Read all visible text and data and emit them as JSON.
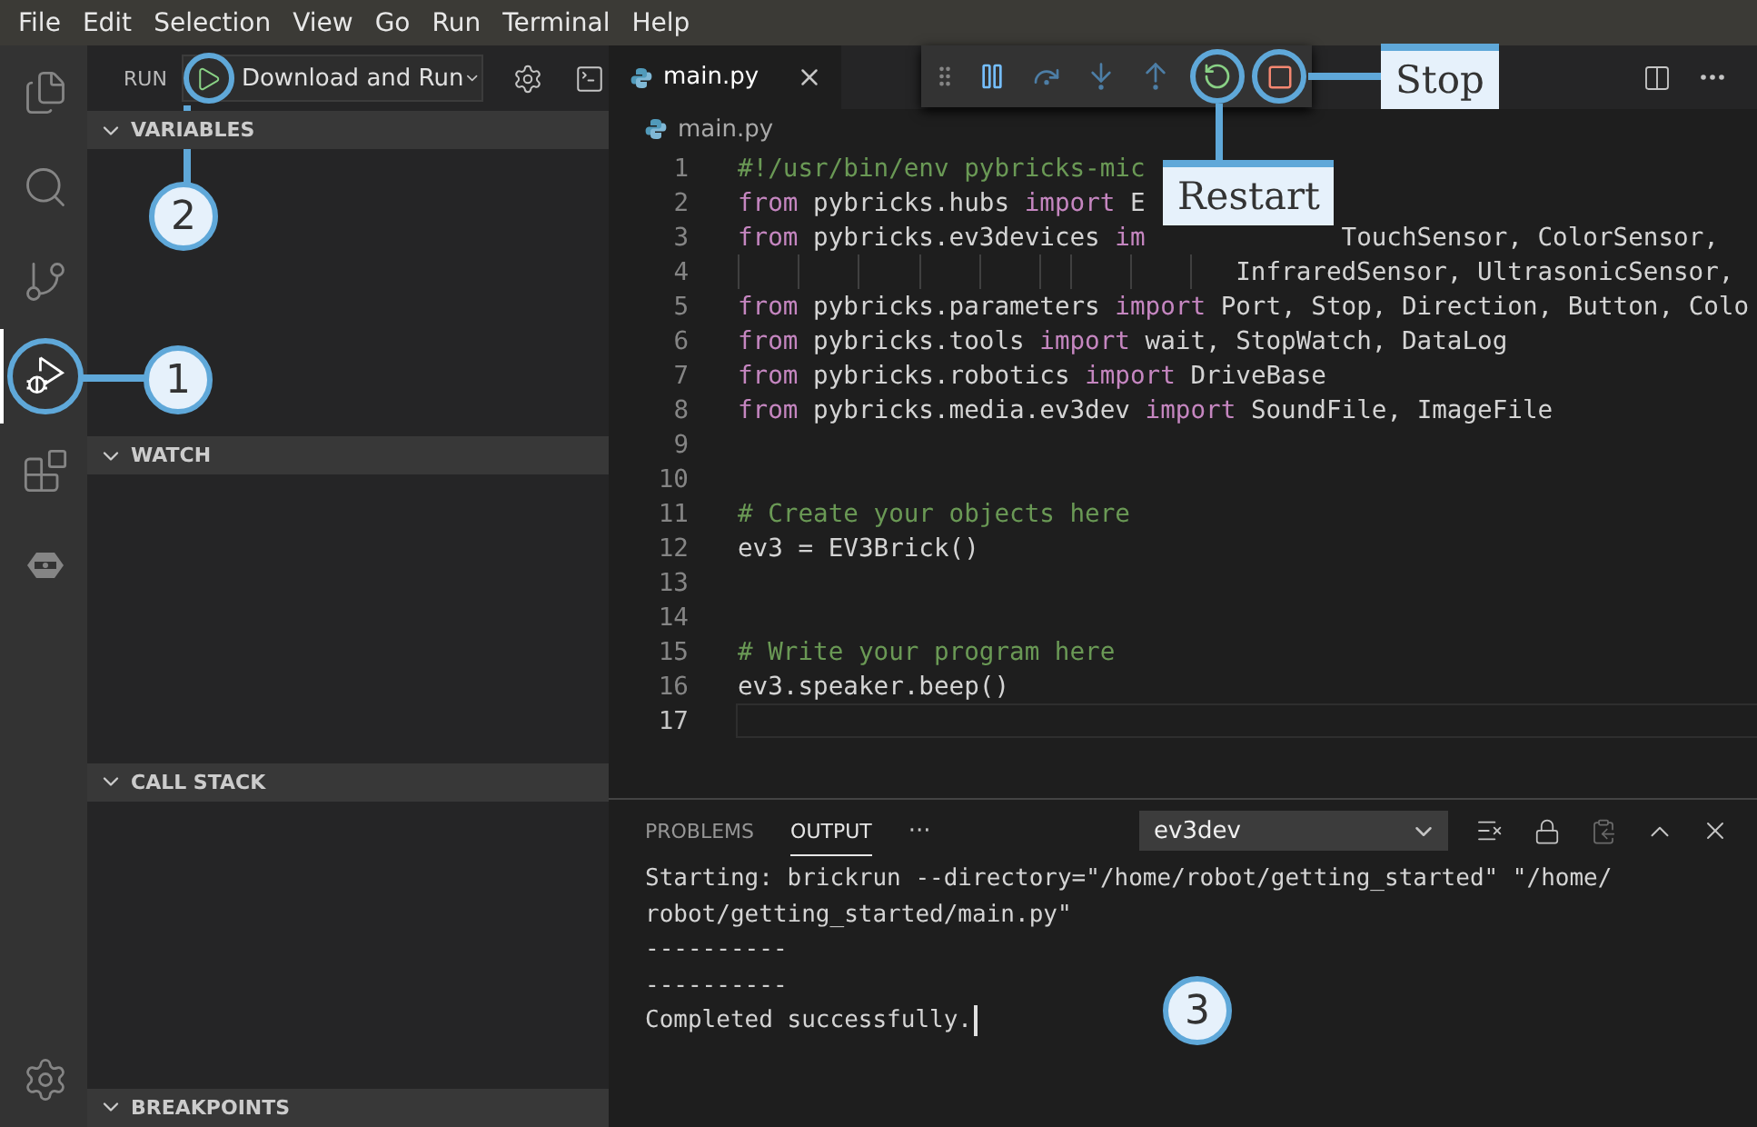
{
  "menu_bar": {
    "items": [
      "File",
      "Edit",
      "Selection",
      "View",
      "Go",
      "Run",
      "Terminal",
      "Help"
    ]
  },
  "activity_bar": {
    "items": [
      {
        "selected": false
      },
      {
        "selected": false
      },
      {
        "selected": false
      },
      {
        "selected": true
      },
      {
        "selected": false
      },
      {
        "selected": false
      }
    ]
  },
  "sidebar": {
    "title": "RUN",
    "configuration": "Download and Run",
    "sections": [
      {
        "title": "VARIABLES",
        "expanded": true
      },
      {
        "title": "WATCH",
        "expanded": true
      },
      {
        "title": "CALL STACK",
        "expanded": true
      },
      {
        "title": "BREAKPOINTS",
        "expanded": true
      }
    ]
  },
  "editor": {
    "tabs": [
      {
        "label": "main.py",
        "selected": true
      }
    ],
    "breadcrumb": "main.py",
    "lines": [
      {
        "number": "1",
        "current": false,
        "segments": [
          [
            {
              "kind": "comment",
              "text": "#!/usr/bin/env pybricks-mic"
            }
          ]
        ]
      },
      {
        "number": "2",
        "current": false,
        "segments": [
          [
            {
              "kind": "keyword",
              "text": "from"
            },
            {
              "kind": "plain",
              "text": " pybricks.hubs "
            },
            {
              "kind": "keyword",
              "text": "import"
            },
            {
              "kind": "plain",
              "text": " E"
            }
          ]
        ]
      },
      {
        "number": "3",
        "current": false,
        "segments": [
          [
            {
              "kind": "keyword",
              "text": "from"
            },
            {
              "kind": "plain",
              "text": " pybricks.ev3devices "
            },
            {
              "kind": "keyword",
              "text": "im"
            }
          ],
          [
            {
              "kind": "plain",
              "text": "TouchSensor, ColorSensor,"
            }
          ]
        ]
      },
      {
        "number": "4",
        "current": false,
        "continuation": true,
        "segments": [
          [
            {
              "kind": "plain",
              "text": "InfraredSensor, UltrasonicSensor,"
            }
          ]
        ]
      },
      {
        "number": "5",
        "current": false,
        "segments": [
          [
            {
              "kind": "keyword",
              "text": "from"
            },
            {
              "kind": "plain",
              "text": " pybricks.parameters "
            },
            {
              "kind": "keyword",
              "text": "import"
            },
            {
              "kind": "plain",
              "text": " Port, Stop, Direction, Button, Colo"
            }
          ]
        ]
      },
      {
        "number": "6",
        "current": false,
        "segments": [
          [
            {
              "kind": "keyword",
              "text": "from"
            },
            {
              "kind": "plain",
              "text": " pybricks.tools "
            },
            {
              "kind": "keyword",
              "text": "import"
            },
            {
              "kind": "plain",
              "text": " wait, StopWatch, DataLog"
            }
          ]
        ]
      },
      {
        "number": "7",
        "current": false,
        "segments": [
          [
            {
              "kind": "keyword",
              "text": "from"
            },
            {
              "kind": "plain",
              "text": " pybricks.robotics "
            },
            {
              "kind": "keyword",
              "text": "import"
            },
            {
              "kind": "plain",
              "text": " DriveBase"
            }
          ]
        ]
      },
      {
        "number": "8",
        "current": false,
        "segments": [
          [
            {
              "kind": "keyword",
              "text": "from"
            },
            {
              "kind": "plain",
              "text": " pybricks.media.ev3dev "
            },
            {
              "kind": "keyword",
              "text": "import"
            },
            {
              "kind": "plain",
              "text": " SoundFile, ImageFile"
            }
          ]
        ]
      },
      {
        "number": "9",
        "current": false
      },
      {
        "number": "10",
        "current": false
      },
      {
        "number": "11",
        "current": false,
        "segments": [
          [
            {
              "kind": "comment",
              "text": "# Create your objects here"
            }
          ]
        ]
      },
      {
        "number": "12",
        "current": false,
        "segments": [
          [
            {
              "kind": "plain",
              "text": "ev3 = EV3Brick()"
            }
          ]
        ]
      },
      {
        "number": "13",
        "current": false
      },
      {
        "number": "14",
        "current": false
      },
      {
        "number": "15",
        "current": false,
        "segments": [
          [
            {
              "kind": "comment",
              "text": "# Write your program here"
            }
          ]
        ]
      },
      {
        "number": "16",
        "current": false,
        "segments": [
          [
            {
              "kind": "plain",
              "text": "ev3.speaker.beep()"
            }
          ]
        ]
      },
      {
        "number": "17",
        "current": true
      }
    ]
  },
  "panel": {
    "tabs": [
      {
        "label": "PROBLEMS",
        "selected": false
      },
      {
        "label": "OUTPUT",
        "selected": true
      }
    ],
    "more": "···",
    "channel": "ev3dev",
    "output": [
      "Starting: brickrun --directory=\"/home/robot/getting_started\" \"/home/",
      "robot/getting_started/main.py\"",
      "----------",
      "----------",
      "Completed successfully."
    ]
  },
  "annotations": {
    "markers": [
      "1",
      "2",
      "3"
    ],
    "labels": [
      "Restart",
      "Stop"
    ]
  }
}
